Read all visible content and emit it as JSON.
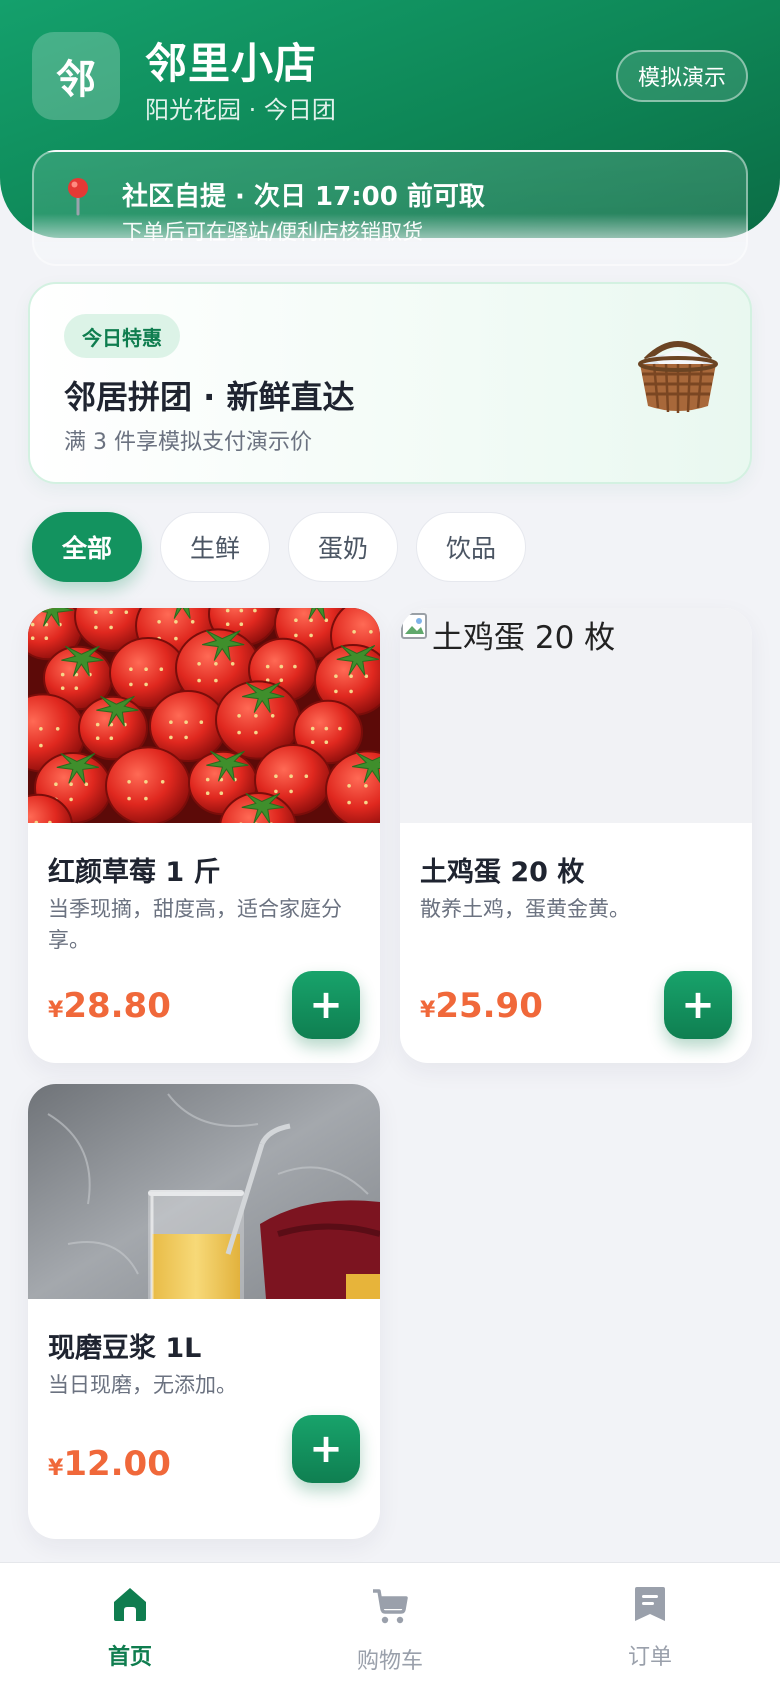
{
  "header": {
    "logo_char": "邻",
    "shop_name": "邻里小店",
    "shop_sub": "阳光花园 · 今日团",
    "demo_button": "模拟演示"
  },
  "pickup": {
    "icon": "map-pin-icon",
    "title": "社区自提 · 次日 17:00 前可取",
    "subtitle": "下单后可在驿站/便利店核销取货"
  },
  "promo": {
    "badge": "今日特惠",
    "title": "邻居拼团 · 新鲜直达",
    "subtitle": "满 3 件享模拟支付演示价",
    "icon": "basket-icon"
  },
  "categories": [
    "全部",
    "生鲜",
    "蛋奶",
    "饮品"
  ],
  "selected_category": "全部",
  "products": [
    {
      "title": "红颜草莓 1 斤",
      "desc": "当季现摘，甜度高，适合家庭分享。",
      "currency": "¥",
      "price": "28.80",
      "image": "strawberries"
    },
    {
      "title": "土鸡蛋 20 枚",
      "desc": "散养土鸡，蛋黄金黄。",
      "currency": "¥",
      "price": "25.90",
      "image_alt": "土鸡蛋 20 枚"
    },
    {
      "title": "现磨豆浆 1L",
      "desc": "当日现磨，无添加。",
      "currency": "¥",
      "price": "12.00",
      "image": "smoothie-glass"
    }
  ],
  "add_button": "+",
  "nav": [
    {
      "label": "首页",
      "icon": "home-icon",
      "active": true
    },
    {
      "label": "购物车",
      "icon": "cart-icon",
      "active": false
    },
    {
      "label": "订单",
      "icon": "order-icon",
      "active": false
    }
  ],
  "colors": {
    "brand": "#13935f",
    "price": "#f0683a"
  }
}
